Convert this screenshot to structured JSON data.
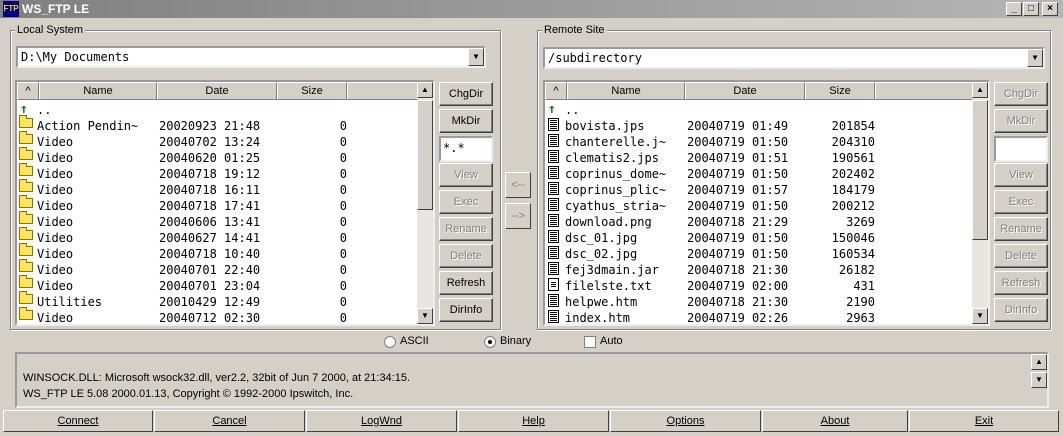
{
  "window": {
    "title": "WS_FTP LE",
    "icon": "ftp-app-icon"
  },
  "local": {
    "group_label": "Local System",
    "path": "D:\\My Documents",
    "columns": [
      "^",
      "Name",
      "Date",
      "Size"
    ],
    "parent": "..",
    "rows": [
      {
        "name": "Action Pendin~",
        "date": "20020923 21:48",
        "size": "0"
      },
      {
        "name": "Video",
        "date": "20040702 13:24",
        "size": "0"
      },
      {
        "name": "Video",
        "date": "20040620 01:25",
        "size": "0"
      },
      {
        "name": "Video",
        "date": "20040718 19:12",
        "size": "0"
      },
      {
        "name": "Video",
        "date": "20040718 16:11",
        "size": "0"
      },
      {
        "name": "Video",
        "date": "20040718 17:41",
        "size": "0"
      },
      {
        "name": "Video",
        "date": "20040606 13:41",
        "size": "0"
      },
      {
        "name": "Video",
        "date": "20040627 14:41",
        "size": "0"
      },
      {
        "name": "Video",
        "date": "20040718 10:40",
        "size": "0"
      },
      {
        "name": "Video",
        "date": "20040701 22:40",
        "size": "0"
      },
      {
        "name": "Video",
        "date": "20040701 23:04",
        "size": "0"
      },
      {
        "name": "Utilities",
        "date": "20010429 12:49",
        "size": "0"
      },
      {
        "name": "Video",
        "date": "20040712 02:30",
        "size": "0"
      }
    ],
    "buttons": {
      "chgdir": "ChgDir",
      "mkdir": "MkDir",
      "filter": "*.*",
      "view": "View",
      "exec": "Exec",
      "rename": "Rename",
      "delete": "Delete",
      "refresh": "Refresh",
      "dirinfo": "DirInfo"
    }
  },
  "remote": {
    "group_label": "Remote Site",
    "path": "/subdirectory",
    "columns": [
      "^",
      "Name",
      "Date",
      "Size"
    ],
    "parent": "..",
    "rows": [
      {
        "name": "bovista.jps",
        "date": "20040719 01:49",
        "size": "201854",
        "kind": "bin"
      },
      {
        "name": "chanterelle.j~",
        "date": "20040719 01:50",
        "size": "204310",
        "kind": "bin"
      },
      {
        "name": "clematis2.jps",
        "date": "20040719 01:51",
        "size": "190561",
        "kind": "bin"
      },
      {
        "name": "coprinus_dome~",
        "date": "20040719 01:50",
        "size": "202402",
        "kind": "bin"
      },
      {
        "name": "coprinus_plic~",
        "date": "20040719 01:57",
        "size": "184179",
        "kind": "bin"
      },
      {
        "name": "cyathus_stria~",
        "date": "20040719 01:50",
        "size": "200212",
        "kind": "bin"
      },
      {
        "name": "download.png",
        "date": "20040718 21:29",
        "size": "3269",
        "kind": "bin"
      },
      {
        "name": "dsc_01.jpg",
        "date": "20040719 01:50",
        "size": "150046",
        "kind": "bin"
      },
      {
        "name": "dsc_02.jpg",
        "date": "20040719 01:50",
        "size": "160534",
        "kind": "bin"
      },
      {
        "name": "fej3dmain.jar",
        "date": "20040718 21:30",
        "size": "26182",
        "kind": "bin"
      },
      {
        "name": "filelste.txt",
        "date": "20040719 02:00",
        "size": "431",
        "kind": "txt"
      },
      {
        "name": "helpwe.htm",
        "date": "20040718 21:30",
        "size": "2190",
        "kind": "bin"
      },
      {
        "name": "index.htm",
        "date": "20040719 02:26",
        "size": "2963",
        "kind": "bin"
      }
    ],
    "buttons": {
      "chgdir": "ChgDir",
      "mkdir": "MkDir",
      "filter": "",
      "view": "View",
      "exec": "Exec",
      "rename": "Rename",
      "delete": "Delete",
      "refresh": "Refresh",
      "dirinfo": "DirInfo"
    }
  },
  "transfer": {
    "to_local": "<--",
    "to_remote": "-->"
  },
  "mode": {
    "ascii": "ASCII",
    "binary": "Binary",
    "auto": "Auto",
    "selected": "Binary"
  },
  "log": {
    "line1": "WINSOCK.DLL: Microsoft wsock32.dll, ver2.2, 32bit of Jun  7 2000, at 21:34:15.",
    "line2": "WS_FTP LE 5.08 2000.01.13, Copyright © 1992-2000 Ipswitch, Inc."
  },
  "bottom_buttons": [
    "Connect",
    "Cancel",
    "LogWnd",
    "Help",
    "Options",
    "About",
    "Exit"
  ]
}
